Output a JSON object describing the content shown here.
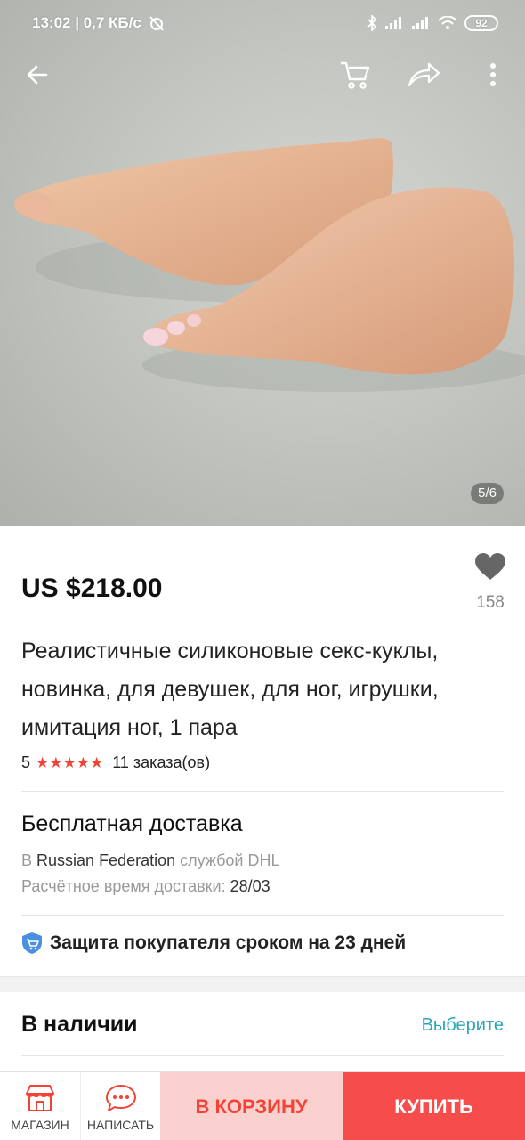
{
  "status_bar": {
    "time_speed": "13:02 | 0,7 КБ/с",
    "battery": "92"
  },
  "gallery": {
    "counter": "5/6"
  },
  "product": {
    "price": "US $218.00",
    "wishlist_count": "158",
    "title": "Реалистичные силиконовые секс-куклы, новинка, для девушек, для ног, игрушки, имитация ног, 1 пара",
    "rating": {
      "score": "5",
      "stars": 5,
      "stars_text": "★★★★★",
      "orders": "11 заказа(ов)"
    }
  },
  "shipping": {
    "title": "Бесплатная доставка",
    "prefix": "В",
    "country": "Russian Federation",
    "carrier": "службой DHL",
    "eta_label": "Расчётное время доставки:",
    "eta_date": "28/03"
  },
  "protection": {
    "text": "Защита покупателя сроком на 23 дней"
  },
  "stock": {
    "label": "В наличии",
    "action": "Выберите"
  },
  "bottom_bar": {
    "store": "МАГАЗИН",
    "message": "НАПИСАТЬ",
    "add_to_cart": "В КОРЗИНУ",
    "buy": "КУПИТЬ"
  },
  "colors": {
    "accent_red": "#f64c4b",
    "cart_pink": "#fbd1d0",
    "link_teal": "#2aa5b6",
    "star_red": "#f44336"
  }
}
